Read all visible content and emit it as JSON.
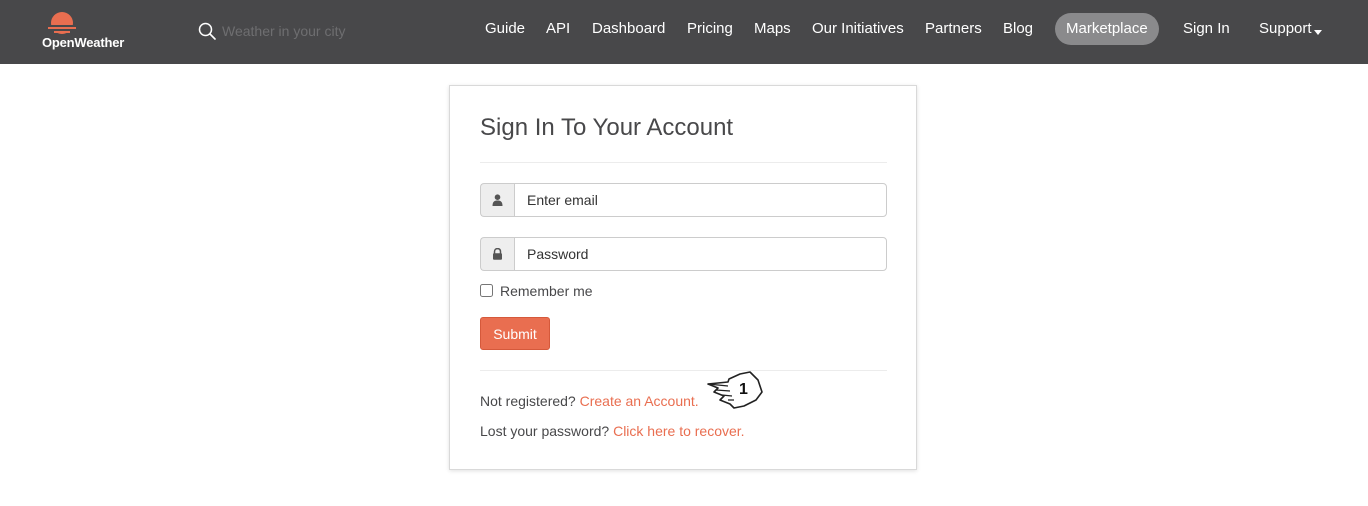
{
  "navbar": {
    "logo_text": "OpenWeather",
    "search_placeholder": "Weather in your city",
    "items": [
      {
        "label": "Guide"
      },
      {
        "label": "API"
      },
      {
        "label": "Dashboard"
      },
      {
        "label": "Pricing"
      },
      {
        "label": "Maps"
      },
      {
        "label": "Our Initiatives"
      },
      {
        "label": "Partners"
      },
      {
        "label": "Blog"
      },
      {
        "label": "Marketplace"
      },
      {
        "label": "Sign In"
      },
      {
        "label": "Support"
      }
    ],
    "icons": {
      "logo": "openweather-logo-icon",
      "search": "search-icon",
      "support_dropdown": "caret-down-icon"
    }
  },
  "signin": {
    "title": "Sign In To Your Account",
    "email_placeholder": "Enter email",
    "password_placeholder": "Password",
    "remember_label": "Remember me",
    "remember_checked": false,
    "submit_label": "Submit",
    "not_registered_text": "Not registered?",
    "create_account_link": "Create an Account.",
    "lost_password_text": "Lost your password?",
    "recover_link": "Click here to recover.",
    "icons": {
      "email": "user-icon",
      "password": "lock-icon"
    }
  },
  "annotation": {
    "cursor_label": "1",
    "cursor_icon": "pointing-hand-cursor-icon"
  },
  "colors": {
    "navbar_bg": "#48484a",
    "accent": "#e96e50",
    "marketplace_pill": "#8a8a8c"
  }
}
